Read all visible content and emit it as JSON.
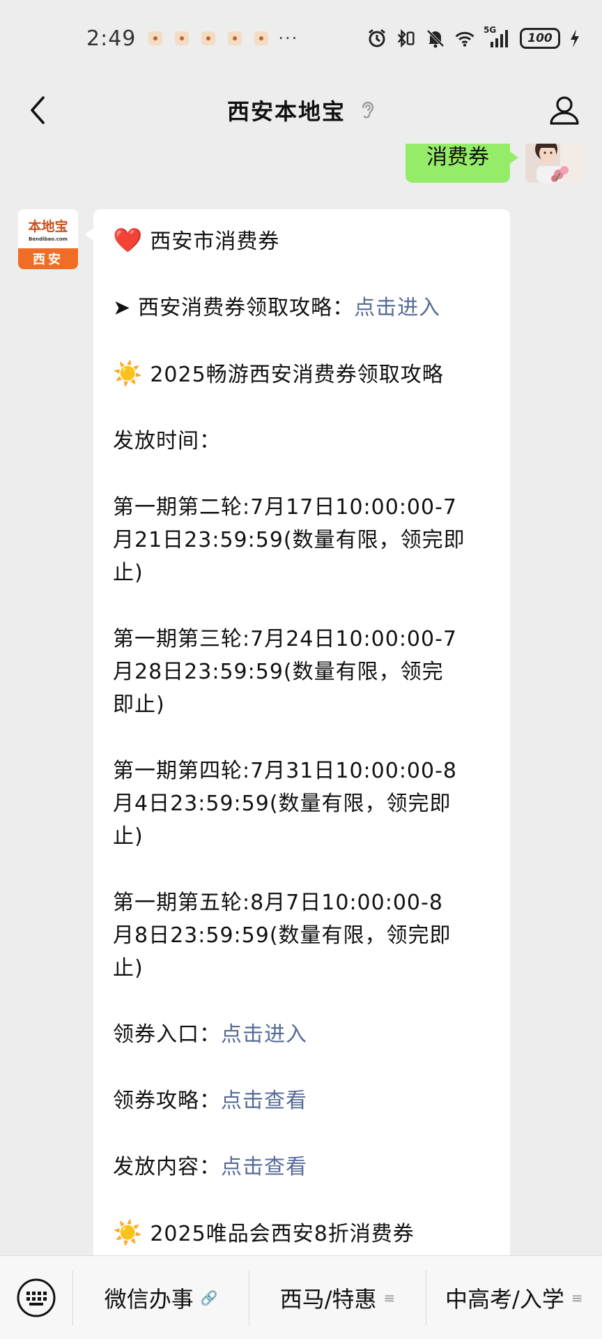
{
  "status_bar": {
    "time": "2:49",
    "more": "···",
    "network": "5G",
    "battery": "100"
  },
  "header": {
    "title": "西安本地宝",
    "back_icon": "chevron-left-icon",
    "ear_icon": "ear-icon",
    "profile_icon": "person-icon"
  },
  "chat": {
    "sent_message": "消费券",
    "bot_logo": {
      "brand": "本地宝",
      "url": "Bendibao.com",
      "city": "西安"
    },
    "reply": {
      "line1": {
        "icon": "❤️",
        "text": "西安市消费券"
      },
      "line2": {
        "icon": "➤",
        "text": "西安消费券领取攻略：",
        "link": "点击进入"
      },
      "line3": {
        "icon": "☀️",
        "text": "2025畅游西安消费券领取攻略"
      },
      "release_time_label": "发放时间：",
      "rounds": [
        {
          "lines": [
            "第一期第二轮:7月17日10:00:00-7",
            "月21日23:59:59(数量有限，领完即",
            "止)"
          ]
        },
        {
          "lines": [
            "第一期第三轮:7月24日10:00:00-7",
            "月28日23:59:59(数量有限，领完",
            "即止)"
          ]
        },
        {
          "lines": [
            "第一期第四轮:7月31日10:00:00-8",
            "月4日23:59:59(数量有限，领完即",
            "止)"
          ]
        },
        {
          "lines": [
            "第一期第五轮:8月7日10:00:00-8",
            "月8日23:59:59(数量有限，领完即",
            "止)"
          ]
        }
      ],
      "entry": {
        "label": "领券入口：",
        "link": "点击进入"
      },
      "guide": {
        "label": "领券攻略：",
        "link": "点击查看"
      },
      "content": {
        "label": "发放内容：",
        "link": "点击查看"
      },
      "line_last": {
        "icon": "☀️",
        "text": "2025唯品会西安8折消费券"
      }
    }
  },
  "bottom_menu": {
    "keyboard_icon": "keyboard-icon",
    "items": [
      {
        "label": "微信办事",
        "suffix": "🔗"
      },
      {
        "label": "西马/特惠",
        "suffix": "≡"
      },
      {
        "label": "中高考/入学",
        "suffix": "≡"
      }
    ]
  },
  "colors": {
    "background": "#ededed",
    "sent_bubble": "#95ec69",
    "link": "#576b95",
    "logo_orange": "#ef6d24"
  }
}
